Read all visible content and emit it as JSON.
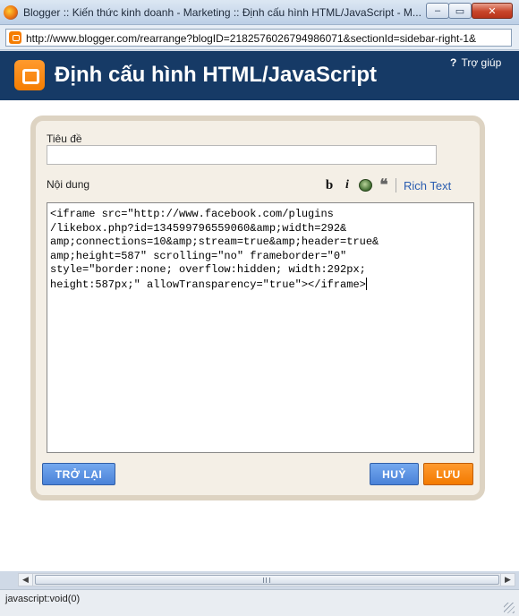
{
  "window": {
    "title": "Blogger :: Kiến thức kinh doanh - Marketing :: Định cấu hình HTML/JavaScript - M...",
    "minimize_label": "–",
    "maximize_label": "▭",
    "close_label": "✕"
  },
  "address_bar": {
    "url": "http://www.blogger.com/rearrange?blogID=2182576026794986071&sectionId=sidebar-right-1&"
  },
  "header": {
    "title": "Định cấu hình HTML/JavaScript",
    "help_icon": "?",
    "help_label": "Trợ giúp"
  },
  "form": {
    "title_label": "Tiêu đề",
    "title_value": "",
    "content_label": "Nội dung",
    "toolbar": {
      "bold": "b",
      "italic": "i",
      "quote": "❝",
      "rich_text_label": "Rich Text"
    },
    "editor_lines": {
      "l1": "<iframe src=\"http://www.facebook.com/plugins",
      "l2": "/likebox.php?id=134599796559060&amp;width=292&",
      "l3": "amp;connections=10&amp;stream=true&amp;header=true&",
      "l4": "amp;height=587\" scrolling=\"no\" frameborder=\"0\"",
      "l5": "style=\"border:none; overflow:hidden; width:292px;",
      "l6": "height:587px;\" allowTransparency=\"true\"></iframe>"
    },
    "buttons": {
      "back": "TRỞ LẠI",
      "cancel": "HUỶ",
      "save": "LƯU"
    }
  },
  "scrollbar": {
    "left_arrow": "◀",
    "right_arrow": "▶"
  },
  "status_bar": {
    "text": "javascript:void(0)"
  },
  "colors": {
    "header_bg": "#163a66",
    "brand_orange": "#f57d00",
    "button_blue": "#4a82d8",
    "link_blue": "#2a5db0"
  },
  "icons": {
    "app": "firefox-icon",
    "site": "blogger-icon",
    "image_tool": "insert-image-icon",
    "quote_tool": "quote-icon"
  }
}
